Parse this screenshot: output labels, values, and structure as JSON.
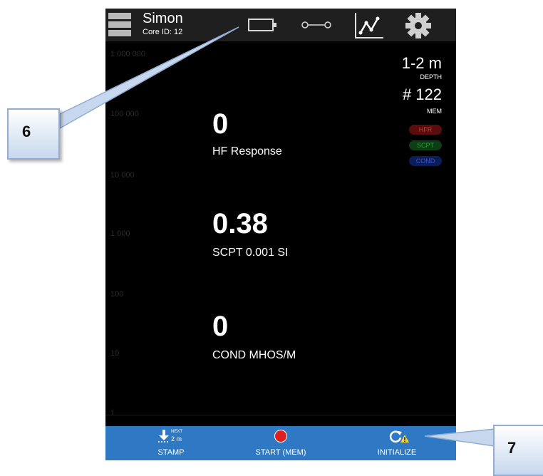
{
  "header": {
    "user_name": "Simon",
    "core_id": "Core ID: 12",
    "icons": [
      "menu-icon",
      "battery-icon",
      "connection-icon",
      "chart-icon",
      "gear-icon"
    ]
  },
  "axis": {
    "labels": [
      "1 000 000",
      "100 000",
      "10 000",
      "1 000",
      "100",
      "10",
      "1"
    ]
  },
  "readings": [
    {
      "value": "0",
      "label": "HF Response"
    },
    {
      "value": "0.38",
      "label": "SCPT 0.001 SI"
    },
    {
      "value": "0",
      "label": "COND MHOS/M"
    }
  ],
  "status": {
    "depth_value": "1-2 m",
    "depth_label": "DEPTH",
    "mem_value": "# 122",
    "mem_label": "MEM"
  },
  "badges": {
    "hfr": "HFR",
    "scpt": "SCPT",
    "cond": "COND",
    "colors": {
      "hfr": "#c23a3a",
      "scpt": "#2f9a3f",
      "cond": "#3a55c2"
    }
  },
  "bottom_bar": {
    "stamp_next": "NEXT",
    "stamp_distance": "2 m",
    "stamp_label": "STAMP",
    "start_label": "START (MEM)",
    "initialize_label": "INITIALIZE",
    "color": "#2f79c4"
  },
  "callouts": {
    "callout_6": "6",
    "callout_7": "7"
  }
}
